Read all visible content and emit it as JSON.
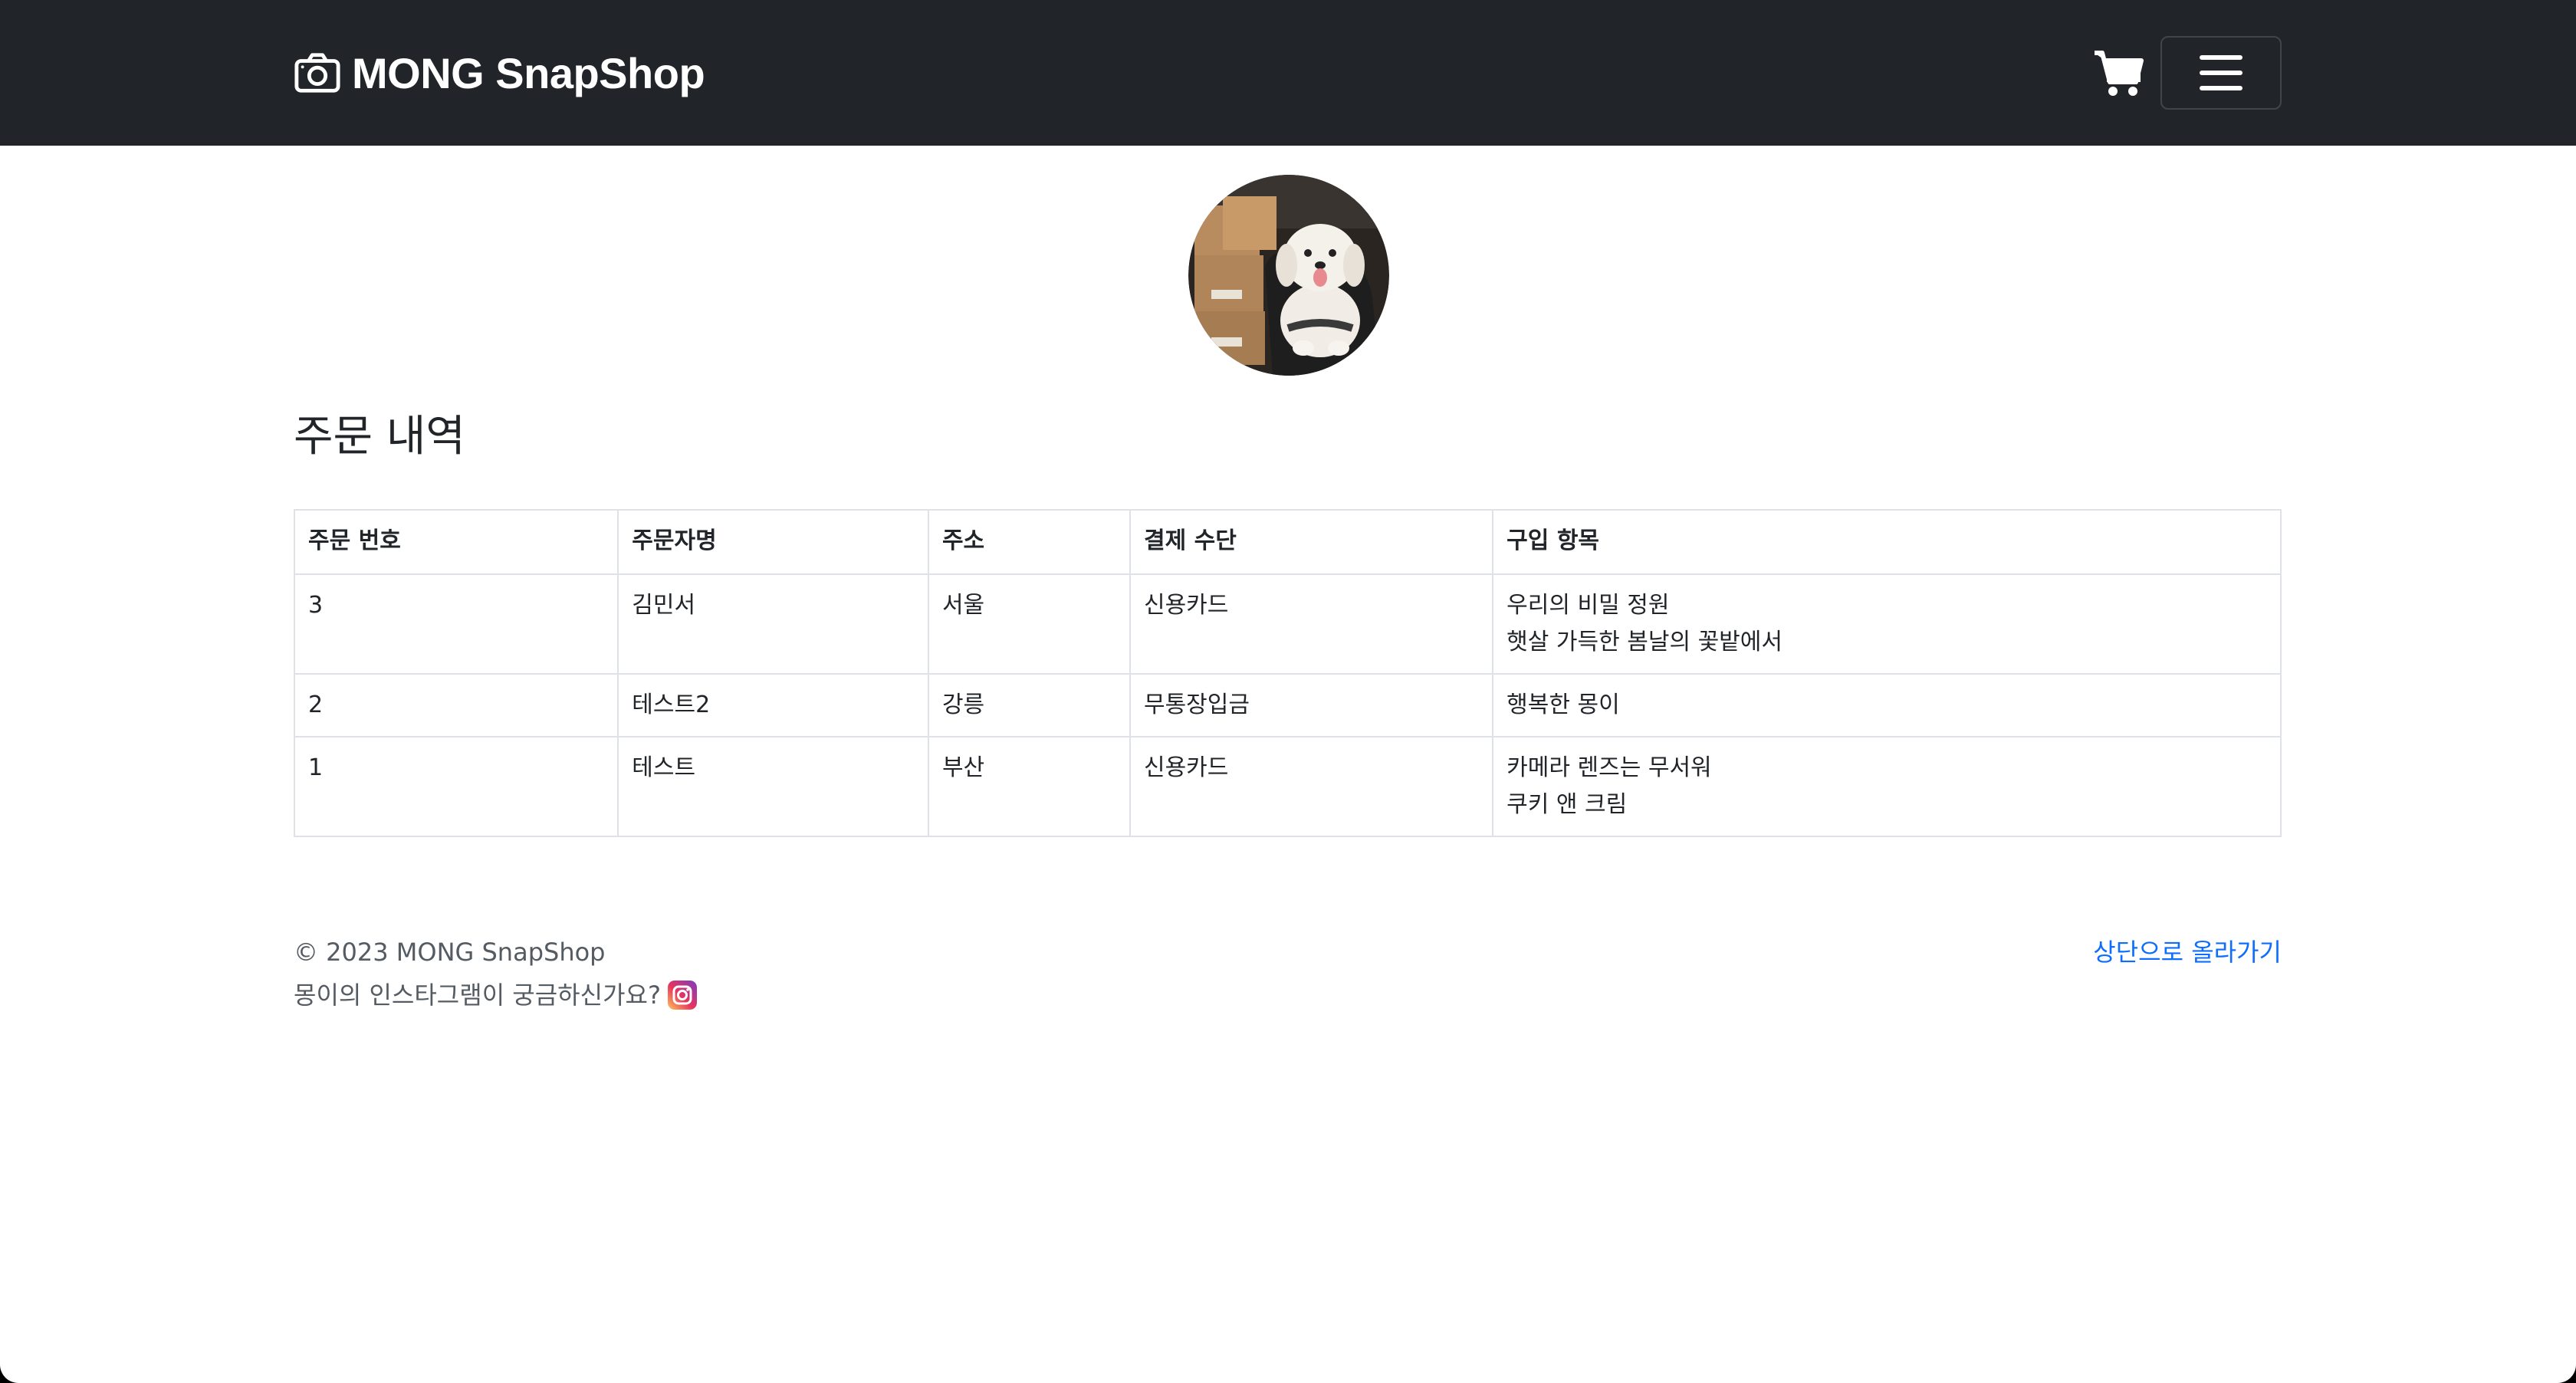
{
  "navbar": {
    "brand_icon": "camera-icon",
    "brand_text": "MONG SnapShop",
    "cart_icon": "cart-icon",
    "menu_icon": "hamburger-icon",
    "background": "#212529"
  },
  "profile": {
    "avatar": "dog-in-car-photo"
  },
  "main": {
    "title": "주문 내역",
    "table": {
      "headers": [
        "주문 번호",
        "주문자명",
        "주소",
        "결제 수단",
        "구입 항목"
      ],
      "rows": [
        {
          "order_no": "3",
          "name": "김민서",
          "address": "서울",
          "payment": "신용카드",
          "items": [
            "우리의 비밀 정원",
            "햇살 가득한 봄날의 꽃밭에서"
          ]
        },
        {
          "order_no": "2",
          "name": "테스트2",
          "address": "강릉",
          "payment": "무통장입금",
          "items": [
            "행복한 몽이"
          ]
        },
        {
          "order_no": "1",
          "name": "테스트",
          "address": "부산",
          "payment": "신용카드",
          "items": [
            "카메라 렌즈는 무서워",
            "쿠키 앤 크림"
          ]
        }
      ]
    }
  },
  "footer": {
    "copyright": "© 2023 MONG SnapShop",
    "instagram_text": "몽이의 인스타그램이 궁금하신가요?",
    "instagram_icon": "instagram-icon",
    "back_to_top": "상단으로 올라가기",
    "link_color": "#0d6efd"
  }
}
